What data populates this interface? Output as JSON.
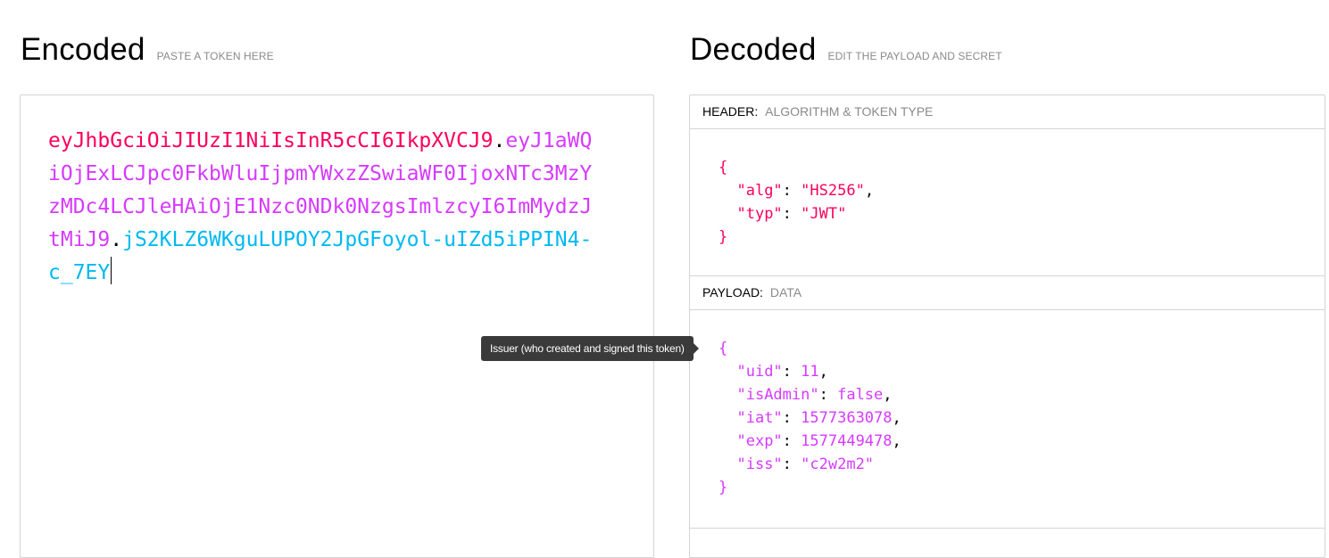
{
  "encoded": {
    "title": "Encoded",
    "subtitle": "PASTE A TOKEN HERE",
    "token": {
      "header": "eyJhbGciOiJIUzI1NiIsInR5cCI6IkpXVCJ9",
      "payload": "eyJ1aWQiOjExLCJpc0FkbWluIjpmYWxzZSwiaWF0IjoxNTc3MzYzMDc4LCJleHAiOjE1Nzc0NDk0NzgsImlzcyI6ImMydzJtMiJ9",
      "signature": "jS2KLZ6WKguLUPOY2JpGFoyol-uIZd5iPPIN4-c_7EY",
      "dot": "."
    }
  },
  "decoded": {
    "title": "Decoded",
    "subtitle": "EDIT THE PAYLOAD AND SECRET",
    "header_section": {
      "label": "HEADER:",
      "sublabel": "ALGORITHM & TOKEN TYPE",
      "open_brace": "{",
      "close_brace": "}",
      "fields": [
        {
          "key": "\"alg\"",
          "value": "\"HS256\"",
          "comma": ","
        },
        {
          "key": "\"typ\"",
          "value": "\"JWT\"",
          "comma": ""
        }
      ]
    },
    "payload_section": {
      "label": "PAYLOAD:",
      "sublabel": "DATA",
      "open_brace": "{",
      "close_brace": "}",
      "fields": [
        {
          "key": "\"uid\"",
          "value": "11",
          "comma": ","
        },
        {
          "key": "\"isAdmin\"",
          "value": "false",
          "comma": ","
        },
        {
          "key": "\"iat\"",
          "value": "1577363078",
          "comma": ","
        },
        {
          "key": "\"exp\"",
          "value": "1577449478",
          "comma": ","
        },
        {
          "key": "\"iss\"",
          "value": "\"c2w2m2\"",
          "comma": ""
        }
      ]
    }
  },
  "tooltip": {
    "text": "Issuer (who created and signed this token)"
  },
  "colors": {
    "header": "#fb015b",
    "payload": "#d63aff",
    "signature": "#00b9f1"
  }
}
